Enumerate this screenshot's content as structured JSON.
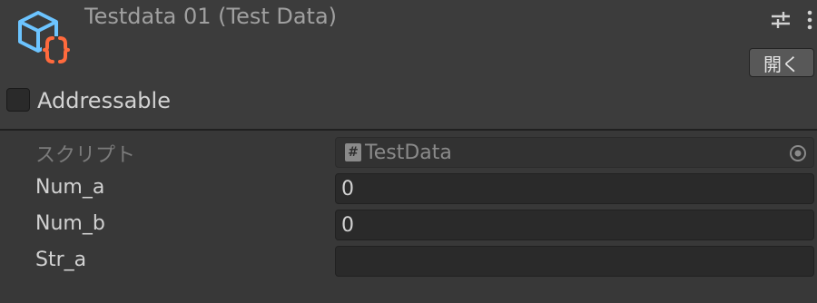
{
  "header": {
    "title": "Testdata 01 (Test Data)",
    "asset_icon": "scriptable-object-icon",
    "settings_icon": "sliders-icon",
    "menu_icon": "kebab-menu-icon",
    "open_label": "開く"
  },
  "addressable": {
    "label": "Addressable",
    "checked": false
  },
  "properties": {
    "script": {
      "label": "スクリプト",
      "value": "TestData",
      "icon": "hash-icon",
      "picker_icon": "object-picker-icon"
    },
    "num_a": {
      "label": "Num_a",
      "value": "0"
    },
    "num_b": {
      "label": "Num_b",
      "value": "0"
    },
    "str_a": {
      "label": "Str_a",
      "value": ""
    }
  },
  "colors": {
    "icon_cube": "#6cc4ff",
    "icon_braces": "#ff6a3d",
    "background": "#383838"
  }
}
